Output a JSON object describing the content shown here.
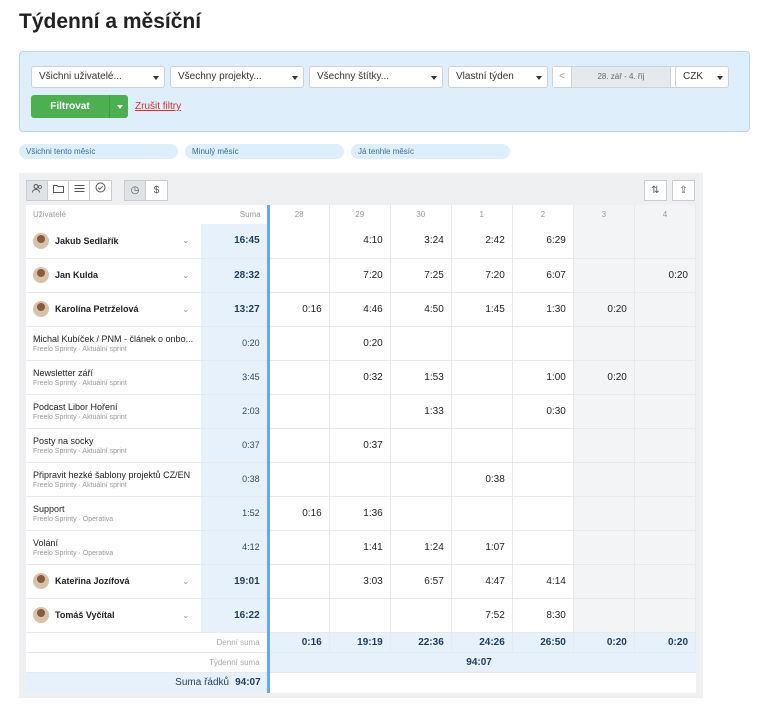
{
  "page_title": "Týdenní a měsíční",
  "filters": {
    "users": "Všichni uživatelé...",
    "projects": "Všechny projekty...",
    "tags": "Všechny štítky...",
    "period": "Vlastní týden",
    "date_prev": "<",
    "date_range": "28. zář - 4. říj",
    "date_next": ">",
    "currency": "CZK",
    "filter_button": "Filtrovat",
    "clear_filters": "Zrušit filtry"
  },
  "quick_filters": [
    "Všichni tento měsíc",
    "Minulý měsíc",
    "Já tenhle měsíc"
  ],
  "toolbar": {
    "left_icons": [
      "users-icon",
      "folder-icon",
      "list-icon",
      "check-circle-icon"
    ],
    "view_icons": [
      "clock-icon",
      "dollar-icon"
    ],
    "right_icons": [
      "sort-icon",
      "export-icon"
    ],
    "view_glyphs": [
      "◷",
      "$"
    ],
    "right_glyphs": [
      "⇅",
      "⇪"
    ]
  },
  "table": {
    "col_users": "Uživatelé",
    "col_sum": "Suma",
    "days": [
      "28",
      "29",
      "30",
      "1",
      "2",
      "3",
      "4"
    ],
    "rows": [
      {
        "type": "user",
        "name": "Jakub Sedlařík",
        "sum": "16:45",
        "values": [
          "",
          "4:10",
          "3:24",
          "2:42",
          "6:29",
          "",
          ""
        ]
      },
      {
        "type": "user",
        "name": "Jan Kulda",
        "sum": "28:32",
        "values": [
          "",
          "7:20",
          "7:25",
          "7:20",
          "6:07",
          "",
          "0:20"
        ]
      },
      {
        "type": "user",
        "name": "Karolína Petrželová",
        "sum": "13:27",
        "values": [
          "0:16",
          "4:46",
          "4:50",
          "1:45",
          "1:30",
          "0:20",
          ""
        ]
      },
      {
        "type": "task",
        "name": "Michal Kubíček / PNM - článek o onbo...",
        "sub": "Freelo Sprinty · Aktuální sprint",
        "sum": "0:20",
        "values": [
          "",
          "0:20",
          "",
          "",
          "",
          "",
          ""
        ]
      },
      {
        "type": "task",
        "name": "Newsletter září",
        "sub": "Freelo Sprinty · Aktuální sprint",
        "sum": "3:45",
        "values": [
          "",
          "0:32",
          "1:53",
          "",
          "1:00",
          "0:20",
          ""
        ]
      },
      {
        "type": "task",
        "name": "Podcast Libor Hoření",
        "sub": "Freelo Sprinty · Aktuální sprint",
        "sum": "2:03",
        "values": [
          "",
          "",
          "1:33",
          "",
          "0:30",
          "",
          ""
        ]
      },
      {
        "type": "task",
        "name": "Posty na socky",
        "sub": "Freelo Sprinty · Aktuální sprint",
        "sum": "0:37",
        "values": [
          "",
          "0:37",
          "",
          "",
          "",
          "",
          ""
        ]
      },
      {
        "type": "task",
        "name": "Připravit hezké šablony projektů CZ/EN",
        "sub": "Freelo Sprinty · Aktuální sprint",
        "sum": "0:38",
        "values": [
          "",
          "",
          "",
          "0:38",
          "",
          "",
          ""
        ]
      },
      {
        "type": "task",
        "name": "Support",
        "sub": "Freelo Sprinty · Operativa",
        "sum": "1:52",
        "values": [
          "0:16",
          "1:36",
          "",
          "",
          "",
          "",
          ""
        ]
      },
      {
        "type": "task",
        "name": "Volání",
        "sub": "Freelo Sprinty · Operativa",
        "sum": "4:12",
        "values": [
          "",
          "1:41",
          "1:24",
          "1:07",
          "",
          "",
          ""
        ]
      },
      {
        "type": "user",
        "name": "Kateřina Jozífová",
        "sum": "19:01",
        "values": [
          "",
          "3:03",
          "6:57",
          "4:47",
          "4:14",
          "",
          ""
        ]
      },
      {
        "type": "user",
        "name": "Tomáš Vyčítal",
        "sum": "16:22",
        "values": [
          "",
          "",
          "",
          "7:52",
          "8:30",
          "",
          ""
        ]
      }
    ],
    "daily_label": "Denní suma",
    "daily_sums": [
      "0:16",
      "19:19",
      "22:36",
      "24:26",
      "26:50",
      "0:20",
      "0:20"
    ],
    "weekly_label": "Týdenní suma",
    "weekly_sum": "94:07",
    "rows_label": "Suma řádků",
    "rows_sum": "94:07"
  }
}
